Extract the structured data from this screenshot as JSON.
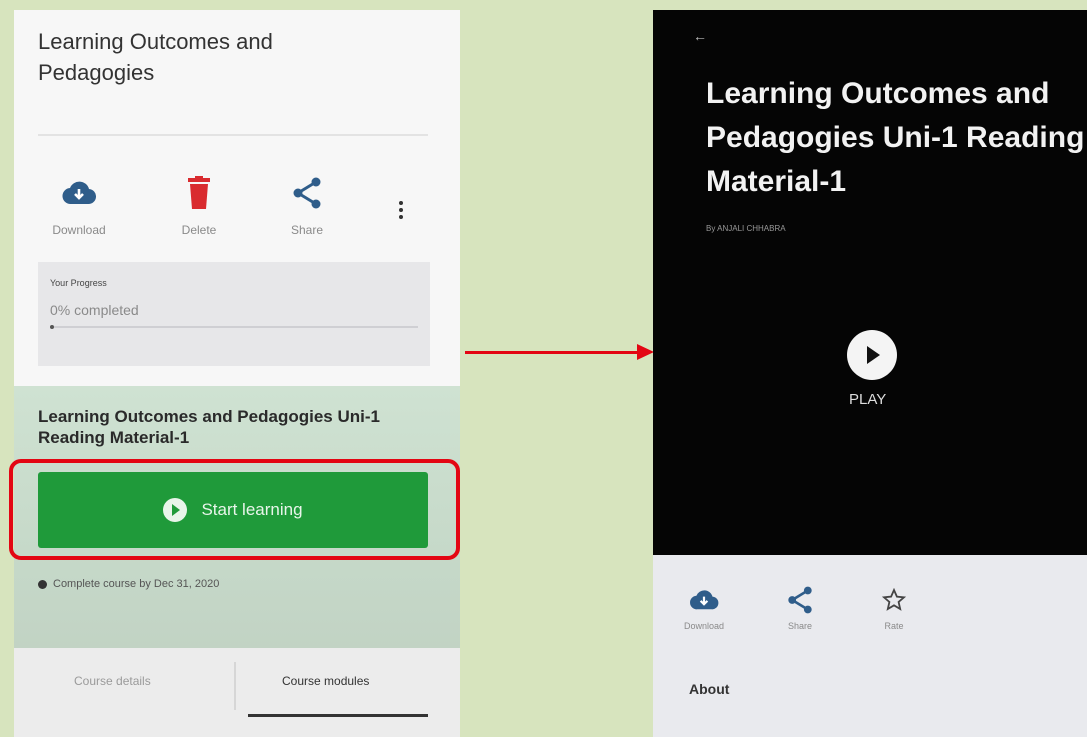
{
  "left_screen": {
    "course_title": "Learning Outcomes and Pedagogies",
    "actions": [
      {
        "label": "Download",
        "icon": "cloud-download-icon",
        "color": "#2f5d8a"
      },
      {
        "label": "Delete",
        "icon": "trash-icon",
        "color": "#d92b2f"
      },
      {
        "label": "Share",
        "icon": "share-icon",
        "color": "#2f5d8a"
      }
    ],
    "more_icon": "more-vertical-icon",
    "progress": {
      "title": "Your Progress",
      "value_text": "0% completed",
      "fraction": 0.0
    },
    "module_title": "Learning Outcomes and Pedagogies Uni-1 Reading Material-1",
    "start_button_label": "Start learning",
    "complete_by_text": "Complete course by Dec 31, 2020",
    "tabs": [
      {
        "label": "Course details",
        "active": false
      },
      {
        "label": "Course modules",
        "active": true
      }
    ],
    "accent_color": "#1f9a3a",
    "highlight_color": "#e30613"
  },
  "right_screen": {
    "back_icon": "back-arrow-icon",
    "title": "Learning Outcomes and Pedagogies Uni-1 Reading Material-1",
    "author": "By ANJALI CHHABRA",
    "play_label": "PLAY",
    "actions": [
      {
        "label": "Download",
        "icon": "cloud-download-icon"
      },
      {
        "label": "Share",
        "icon": "share-icon"
      },
      {
        "label": "Rate",
        "icon": "star-icon"
      }
    ],
    "about_label": "About"
  }
}
